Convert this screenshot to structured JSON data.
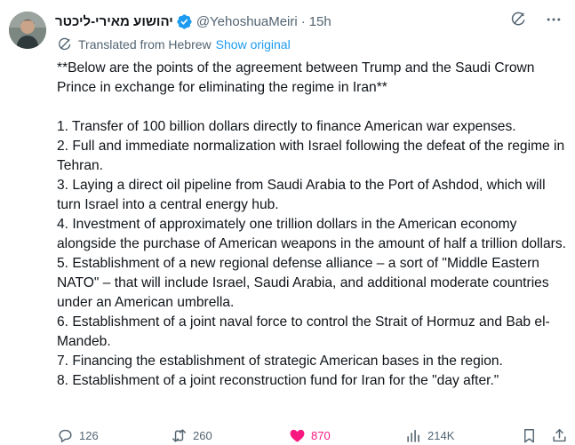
{
  "tweet": {
    "display_name": "יהושוע מאירי-ליכטר",
    "handle": "@YehoshuaMeiri",
    "separator": "·",
    "time": "15h",
    "translated_label": "Translated from Hebrew",
    "show_original": "Show original",
    "intro": "**Below are the points of the agreement between Trump and the Saudi Crown Prince in exchange for eliminating the regime in Iran**",
    "points": [
      "1. Transfer of 100 billion dollars directly to finance American war expenses.",
      "2. Full and immediate normalization with Israel following the defeat of the regime in Tehran.",
      "3. Laying a direct oil pipeline from Saudi Arabia to the Port of Ashdod, which will turn Israel into a central energy hub.",
      "4. Investment of approximately one trillion dollars in the American economy alongside the purchase of American weapons in the amount of half a trillion dollars.",
      "5. Establishment of a new regional defense alliance – a sort of \"Middle Eastern NATO\" – that will include Israel, Saudi Arabia, and additional moderate countries under an American umbrella.",
      "6. Establishment of a joint naval force to control the Strait of Hormuz and Bab el-Mandeb.",
      "7. Financing the establishment of strategic American bases in the region.",
      "8. Establishment of a joint reconstruction fund for Iran for the \"day after.\""
    ],
    "stats": {
      "replies": "126",
      "reposts": "260",
      "likes": "870",
      "views": "214K"
    }
  },
  "colors": {
    "text": "#0f1419",
    "muted": "#536471",
    "link": "#1d9bf0",
    "like": "#f91880",
    "verified": "#1d9bf0"
  },
  "icons": {
    "verified": "verified-badge-icon",
    "grok": "grok-icon",
    "more": "more-icon",
    "translate": "translate-icon",
    "reply": "reply-icon",
    "repost": "repost-icon",
    "like": "heart-icon",
    "views": "views-icon",
    "bookmark": "bookmark-icon",
    "share": "share-icon"
  }
}
